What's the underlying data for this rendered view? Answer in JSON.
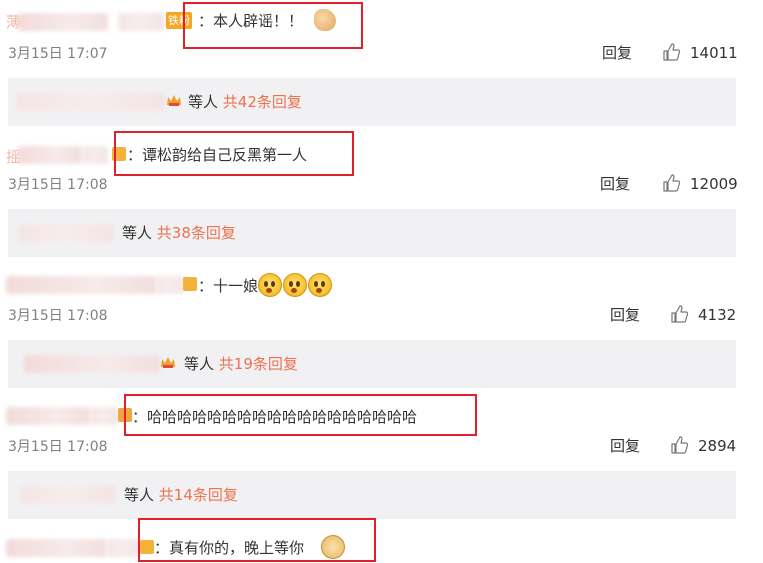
{
  "colors": {
    "accent": "#eb7350",
    "highlight_box": "#e0212b",
    "reply_bg": "#f1f1f3",
    "time": "#808080"
  },
  "comments": [
    {
      "name_prefix": "薄",
      "badge": "铁粉",
      "text": "：本人辟谣！！",
      "emoji": "muscle-emoji",
      "time": "3月15日 17:07",
      "reply_label": "回复",
      "likes": "14011",
      "sub_suffix": "等人",
      "sub_link": "共42条回复"
    },
    {
      "name_prefix": "摇",
      "text": "：谭松韵给自己反黑第一人",
      "time": "3月15日 17:08",
      "reply_label": "回复",
      "likes": "12009",
      "sub_suffix": "等人",
      "sub_link": "共38条回复"
    },
    {
      "text": "：十一娘",
      "emoji": "worried-face-emoji",
      "time": "3月15日 17:08",
      "reply_label": "回复",
      "likes": "4132",
      "sub_suffix": "等人",
      "sub_link": "共19条回复"
    },
    {
      "text": "：哈哈哈哈哈哈哈哈哈哈哈哈哈哈哈哈哈哈",
      "time": "3月15日 17:08",
      "reply_label": "回复",
      "likes": "2894",
      "sub_suffix": "等人",
      "sub_link": "共14条回复"
    },
    {
      "text": "：真有你的，晚上等你",
      "emoji": "doge-emoji"
    }
  ]
}
